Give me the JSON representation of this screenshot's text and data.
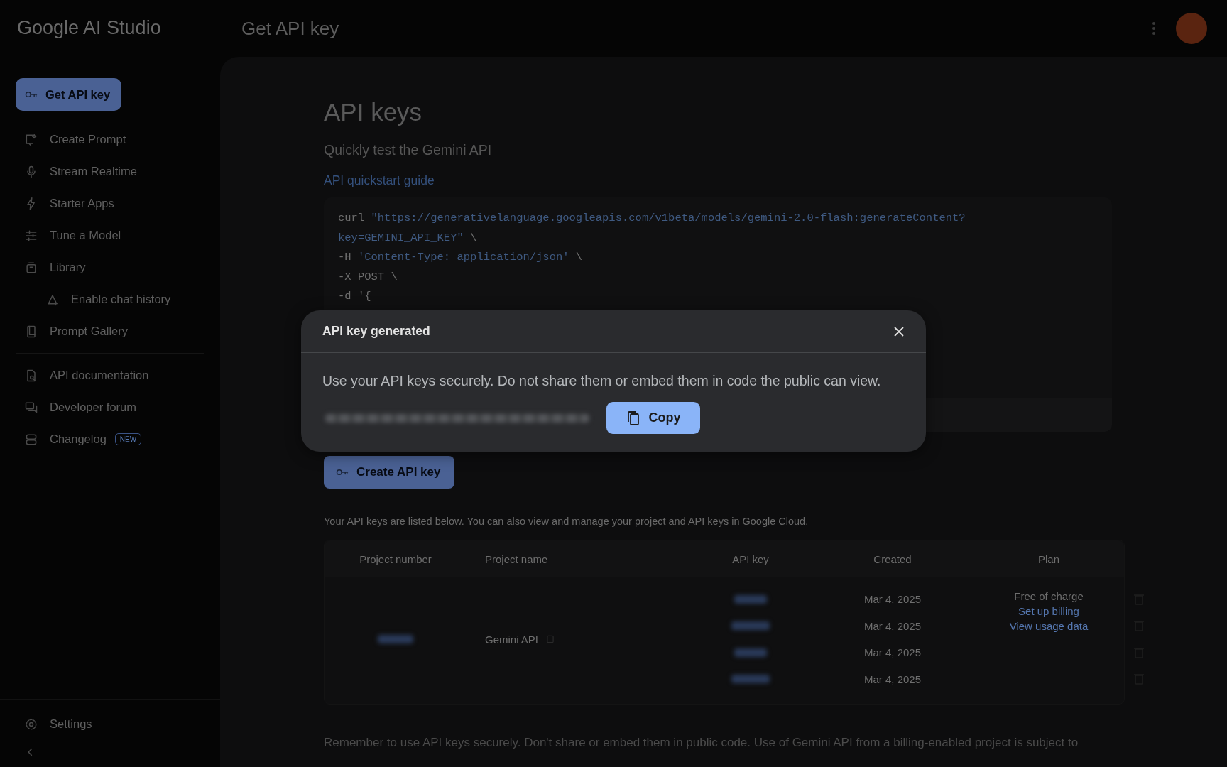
{
  "app": {
    "title": "Google AI Studio"
  },
  "header": {
    "title": "Get API key"
  },
  "sidebar": {
    "primary_button": "Get API key",
    "groups": [
      [
        {
          "label": "Create Prompt",
          "kind": "prompt"
        },
        {
          "label": "Stream Realtime",
          "kind": "mic"
        },
        {
          "label": "Starter Apps",
          "kind": "bolt"
        },
        {
          "label": "Tune a Model",
          "kind": "tune"
        },
        {
          "label": "Library",
          "kind": "library",
          "children": [
            {
              "label": "Enable chat history",
              "kind": "history"
            }
          ]
        },
        {
          "label": "Prompt Gallery",
          "kind": "book"
        }
      ],
      [
        {
          "label": "API documentation",
          "kind": "doc"
        },
        {
          "label": "Developer forum",
          "kind": "forum"
        },
        {
          "label": "Changelog",
          "kind": "changelog",
          "badge": "NEW"
        }
      ]
    ],
    "footer": {
      "settings": "Settings"
    }
  },
  "main": {
    "heading": "API keys",
    "subheading": "Quickly test the Gemini API",
    "link": "API quickstart guide",
    "code_lines": [
      [
        {
          "text": "curl ",
          "kind": "plain"
        },
        {
          "text": "\"https://generativelanguage.googleapis.com/v1beta/models/gemini-2.0-flash:generateContent?",
          "kind": "string"
        }
      ],
      [
        {
          "text": "key=GEMINI_API_KEY\"",
          "kind": "string"
        },
        {
          "text": " \\",
          "kind": "plain"
        }
      ],
      [
        {
          "text": "-H ",
          "kind": "plain"
        },
        {
          "text": "'Content-Type: application/json'",
          "kind": "string"
        },
        {
          "text": " \\",
          "kind": "plain"
        }
      ],
      [
        {
          "text": "-X POST \\",
          "kind": "plain"
        }
      ],
      [
        {
          "text": "-d '{",
          "kind": "plain"
        }
      ]
    ],
    "create_button": "Create API key",
    "description": "Your API keys are listed below. You can also view and manage your project and API keys in Google Cloud.",
    "table": {
      "columns": [
        "Project number",
        "Project name",
        "API key",
        "Created",
        "Plan"
      ],
      "project_name": "Gemini API",
      "rows": [
        {
          "created": "Mar 4, 2025"
        },
        {
          "created": "Mar 4, 2025"
        },
        {
          "created": "Mar 4, 2025"
        },
        {
          "created": "Mar 4, 2025"
        }
      ],
      "plan": {
        "status": "Free of charge",
        "links": [
          "Set up billing",
          "View usage data"
        ]
      }
    },
    "note": "Remember to use API keys securely. Don't share or embed them in public code. Use of Gemini API from a billing-enabled project is subject to"
  },
  "dialog": {
    "title": "API key generated",
    "message": "Use your API keys securely. Do not share them or embed them in code the public can view.",
    "copy_button": "Copy"
  }
}
